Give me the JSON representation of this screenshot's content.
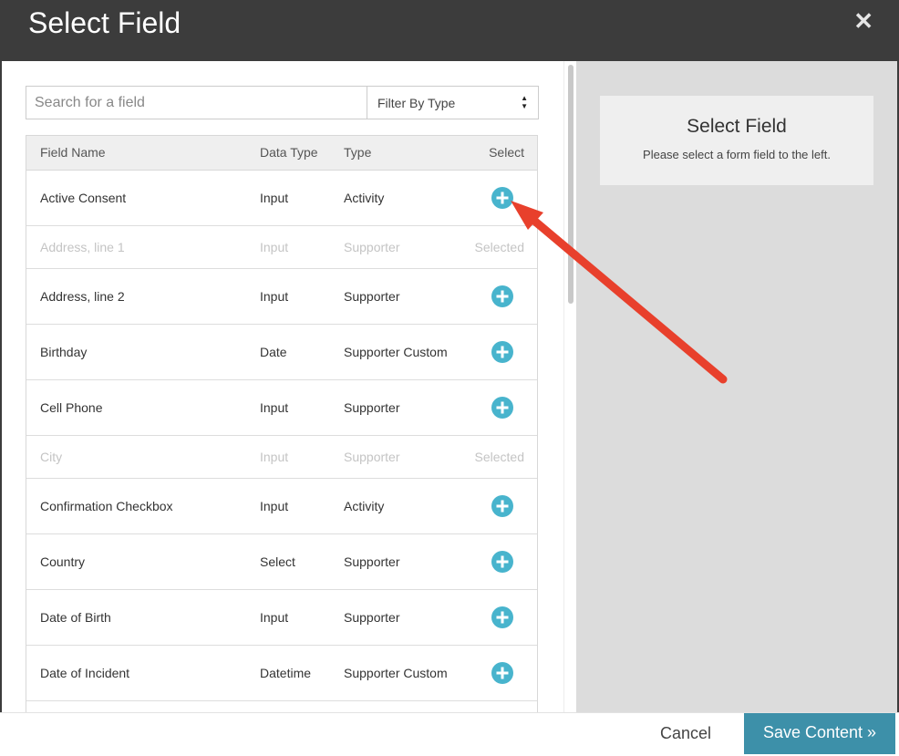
{
  "dialog": {
    "title": "Select Field",
    "close_label": "✕"
  },
  "search": {
    "placeholder": "Search for a field",
    "value": ""
  },
  "filter": {
    "selected": "Filter By Type",
    "arrows": "▲▼"
  },
  "table": {
    "headers": {
      "name": "Field Name",
      "data_type": "Data Type",
      "type": "Type",
      "select": "Select"
    },
    "rows": [
      {
        "name": "Active Consent",
        "data_type": "Input",
        "type": "Activity",
        "selected": false,
        "select_text": ""
      },
      {
        "name": "Address, line 1",
        "data_type": "Input",
        "type": "Supporter",
        "selected": true,
        "select_text": "Selected"
      },
      {
        "name": "Address, line 2",
        "data_type": "Input",
        "type": "Supporter",
        "selected": false,
        "select_text": ""
      },
      {
        "name": "Birthday",
        "data_type": "Date",
        "type": "Supporter Custom",
        "selected": false,
        "select_text": ""
      },
      {
        "name": "Cell Phone",
        "data_type": "Input",
        "type": "Supporter",
        "selected": false,
        "select_text": ""
      },
      {
        "name": "City",
        "data_type": "Input",
        "type": "Supporter",
        "selected": true,
        "select_text": "Selected"
      },
      {
        "name": "Confirmation Checkbox",
        "data_type": "Input",
        "type": "Activity",
        "selected": false,
        "select_text": ""
      },
      {
        "name": "Country",
        "data_type": "Select",
        "type": "Supporter",
        "selected": false,
        "select_text": ""
      },
      {
        "name": "Date of Birth",
        "data_type": "Input",
        "type": "Supporter",
        "selected": false,
        "select_text": ""
      },
      {
        "name": "Date of Incident",
        "data_type": "Datetime",
        "type": "Supporter Custom",
        "selected": false,
        "select_text": ""
      }
    ]
  },
  "preview": {
    "title": "Select Field",
    "text": "Please select a form field to the left."
  },
  "footer": {
    "cancel_label": "Cancel",
    "save_label": "Save Content »"
  },
  "colors": {
    "header_bg": "#3c3c3c",
    "accent": "#48b4cd",
    "save_button": "#3d90a9",
    "annotation_arrow": "#e8402c"
  },
  "icons": {
    "add": "plus-circle-icon",
    "close": "close-icon",
    "select_arrows": "sort-arrows-icon"
  }
}
